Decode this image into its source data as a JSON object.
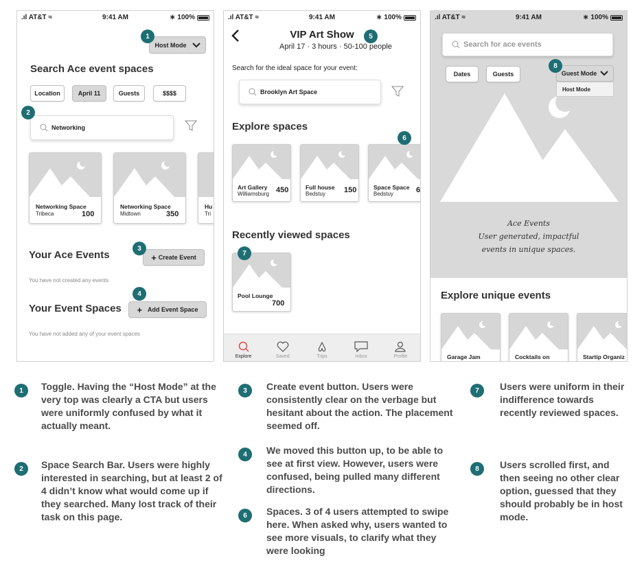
{
  "status": {
    "carrier": "AT&T",
    "time": "9:41 AM",
    "battery": "100%"
  },
  "screen1": {
    "toggle_label": "Host Mode",
    "title": "Search Ace event spaces",
    "filters": [
      "Location",
      "April 11",
      "Guests",
      "$$$$"
    ],
    "search_value": "Networking",
    "cards": [
      {
        "name": "Networking Space",
        "location": "Tribeca",
        "count": "100"
      },
      {
        "name": "Networking Space",
        "location": "Midtown",
        "count": "350"
      },
      {
        "name": "Hu",
        "location": "Tri",
        "count": ""
      }
    ],
    "events_title": "Your Ace Events",
    "create_event": "Create Event",
    "events_empty": "You have not created any events",
    "spaces_title": "Your Event Spaces",
    "add_space": "Add Event Space",
    "spaces_empty": "You have not added any of your event spaces"
  },
  "screen2": {
    "title": "VIP Art Show",
    "subtitle": "April 17 · 3 hours · 50-100 people",
    "prompt": "Search for the ideal space for your event:",
    "search_value": "Brooklyn Art Space",
    "explore_title": "Explore spaces",
    "cards": [
      {
        "name": "Art Gallery",
        "location": "Williamsburg",
        "count": "450"
      },
      {
        "name": "Full house",
        "location": "Bedstuy",
        "count": "150"
      },
      {
        "name": "Space Space",
        "location": "Bedstuy",
        "count": "6"
      }
    ],
    "recent_title": "Recently viewed spaces",
    "recent_card": {
      "name": "Pool Lounge",
      "count": "700"
    },
    "tabs": [
      "Explore",
      "Saved",
      "Trips",
      "Inbox",
      "Profile"
    ]
  },
  "screen3": {
    "search_placeholder": "Search for ace events",
    "filters": [
      "Dates",
      "Guests"
    ],
    "mode_label": "Guest Mode",
    "dropdown_option": "Host Mode",
    "tagline": [
      "Ace Events",
      "User generated, impactful",
      "events in unique spaces."
    ],
    "explore_title": "Explore unique events",
    "cards": [
      {
        "name": "Garage Jam"
      },
      {
        "name": "Cocktails on"
      },
      {
        "name": "Startip Organiz"
      }
    ]
  },
  "badges": [
    "1",
    "2",
    "3",
    "4",
    "5",
    "6",
    "7",
    "8"
  ],
  "notes": {
    "n1": "Toggle. Having the “Host Mode” at the very top was clearly a CTA but users were uniformly confused by what it actually meant.",
    "n2": "Space Search Bar. Users were highly interested in searching, but at least 2 of 4 didn’t know what would come up if they searched. Many lost track of their task on this page.",
    "n3": "Create event button. Users were consistently clear on the verbage but hesitant about the action. The placement seemed off.",
    "n4": "We moved this button up, to be able to see at first view. However, users were confused, being pulled many different directions.",
    "n6": "Spaces. 3 of 4 users attempted to swipe here. When asked why, users wanted to see more visuals, to clarify what they were looking",
    "n7": "Users were uniform in their indifference towards recently reviewed spaces.",
    "n8": "Users scrolled first, and then seeing no other clear option, guessed that they should probably be in host mode."
  },
  "colors": {
    "badge": "#1e6e73",
    "accent": "#e0484d",
    "placeholder_grey": "#d6d6d6"
  }
}
